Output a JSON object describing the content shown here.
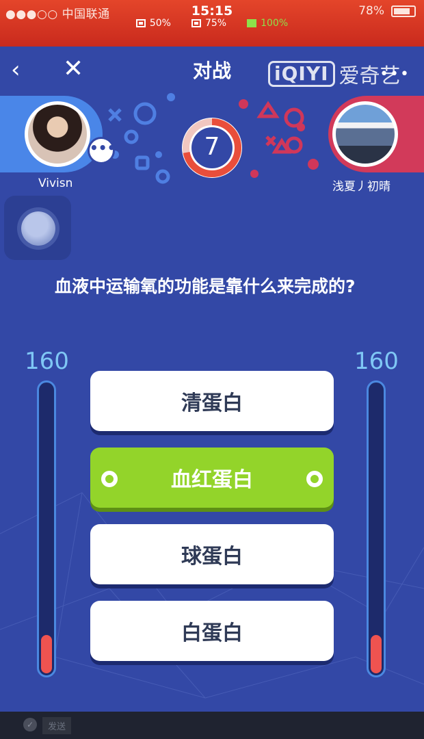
{
  "status_bar": {
    "carrier": "●●●○○ 中国联通",
    "time": "15:15",
    "battery": "78%",
    "stats": [
      {
        "label": "50%"
      },
      {
        "label": "75%"
      },
      {
        "label": "100%"
      }
    ]
  },
  "header": {
    "title": "对战",
    "logo_box": "iQIYI",
    "logo_text": "爱奇艺",
    "back_icon": "‹",
    "close_icon": "✕",
    "more_icon": "•••"
  },
  "players": {
    "left": {
      "name": "Vivisn",
      "score": "160",
      "bar_level": 0.13
    },
    "right": {
      "name": "浅夏丿初晴",
      "score": "160",
      "bar_level": 0.13
    }
  },
  "timer": {
    "value": "7",
    "fraction": 0.72
  },
  "question": "血液中运输氧的功能是靠什么来完成的?",
  "options": [
    {
      "label": "清蛋白",
      "selected": false
    },
    {
      "label": "血红蛋白",
      "selected": true
    },
    {
      "label": "球蛋白",
      "selected": false
    },
    {
      "label": "白蛋白",
      "selected": false
    }
  ],
  "bottom_bar": {
    "send_label": "发送"
  },
  "colors": {
    "background": "#3348a6",
    "status_bar": "#d63324",
    "selected_option": "#93d42a",
    "left_player": "#4a86e8",
    "right_player": "#d23a5a",
    "timer_ring": "#e94e3b",
    "score_bar_fill": "#ef5350",
    "score_text": "#7fc7f5"
  }
}
